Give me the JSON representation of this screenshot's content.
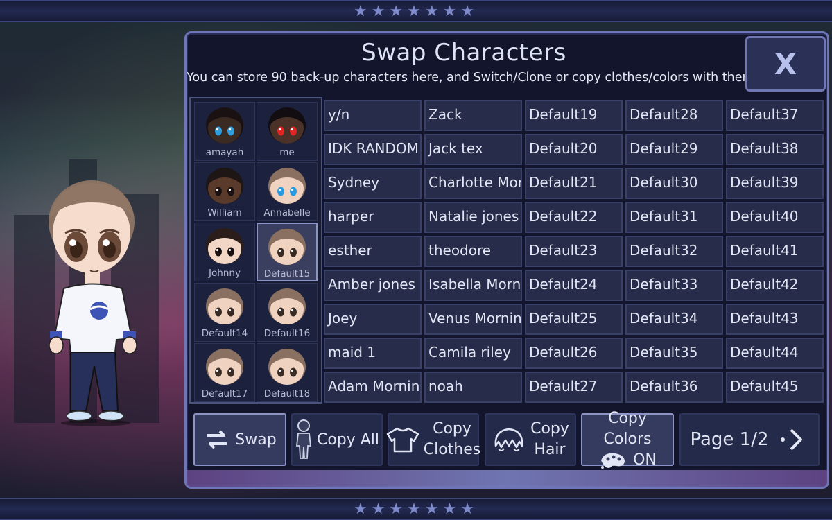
{
  "dialog": {
    "title": "Swap Characters",
    "subtitle": "You can store 90 back-up characters here, and Switch/Clone or copy clothes/colors with them",
    "close_label": "X"
  },
  "slots": [
    {
      "name": "amayah",
      "skin": "#3b2a22",
      "hair": "#1a1212",
      "eye": "#2f9fe0"
    },
    {
      "name": "me",
      "skin": "#4a3228",
      "hair": "#120d10",
      "eye": "#e02525"
    },
    {
      "name": "William",
      "skin": "#5a3a2a",
      "hair": "#1e1614",
      "eye": "#1a1010"
    },
    {
      "name": "Annabelle",
      "skin": "#f0d2c0",
      "hair": "#8a7060",
      "eye": "#2a9ae0"
    },
    {
      "name": "Johnny",
      "skin": "#f2d6c6",
      "hair": "#2a1d1a",
      "eye": "#1a1010"
    },
    {
      "name": "Default15",
      "skin": "#f0d2c0",
      "hair": "#8a7060",
      "eye": "#3a2a24"
    },
    {
      "name": "Default14",
      "skin": "#f0d2c0",
      "hair": "#8a7060",
      "eye": "#3a2a24"
    },
    {
      "name": "Default16",
      "skin": "#f0d2c0",
      "hair": "#8a7060",
      "eye": "#3a2a24"
    },
    {
      "name": "Default17",
      "skin": "#f0d2c0",
      "hair": "#8a7060",
      "eye": "#3a2a24"
    },
    {
      "name": "Default18",
      "skin": "#f0d2c0",
      "hair": "#8a7060",
      "eye": "#3a2a24"
    }
  ],
  "selected_slot": "Default15",
  "names_grid": [
    [
      "y/n",
      "Zack",
      "Default19",
      "Default28",
      "Default37"
    ],
    [
      "IDK RANDOM",
      "Jack tex",
      "Default20",
      "Default29",
      "Default38"
    ],
    [
      "Sydney",
      "Charlotte Morning",
      "Default21",
      "Default30",
      "Default39"
    ],
    [
      "harper",
      "Natalie jones",
      "Default22",
      "Default31",
      "Default40"
    ],
    [
      "esther",
      "theodore",
      "Default23",
      "Default32",
      "Default41"
    ],
    [
      "Amber jones",
      "Isabella Morning",
      "Default24",
      "Default33",
      "Default42"
    ],
    [
      "Joey",
      "Venus Morning",
      "Default25",
      "Default34",
      "Default43"
    ],
    [
      "maid 1",
      "Camila riley",
      "Default26",
      "Default35",
      "Default44"
    ],
    [
      "Adam Morning",
      "noah",
      "Default27",
      "Default36",
      "Default45"
    ]
  ],
  "actions": {
    "swap": "Swap",
    "copy_all": "Copy All",
    "copy_clothes_1": "Copy",
    "copy_clothes_2": "Clothes",
    "copy_hair_1": "Copy",
    "copy_hair_2": "Hair",
    "copy_colors_1": "Copy Colors",
    "copy_colors_2": "ON",
    "page": "Page 1/2"
  },
  "decor": {
    "stars": "★★★★★★★"
  },
  "colors": {
    "panel_border": "#6e76b8",
    "accent": "#8c93c6"
  }
}
